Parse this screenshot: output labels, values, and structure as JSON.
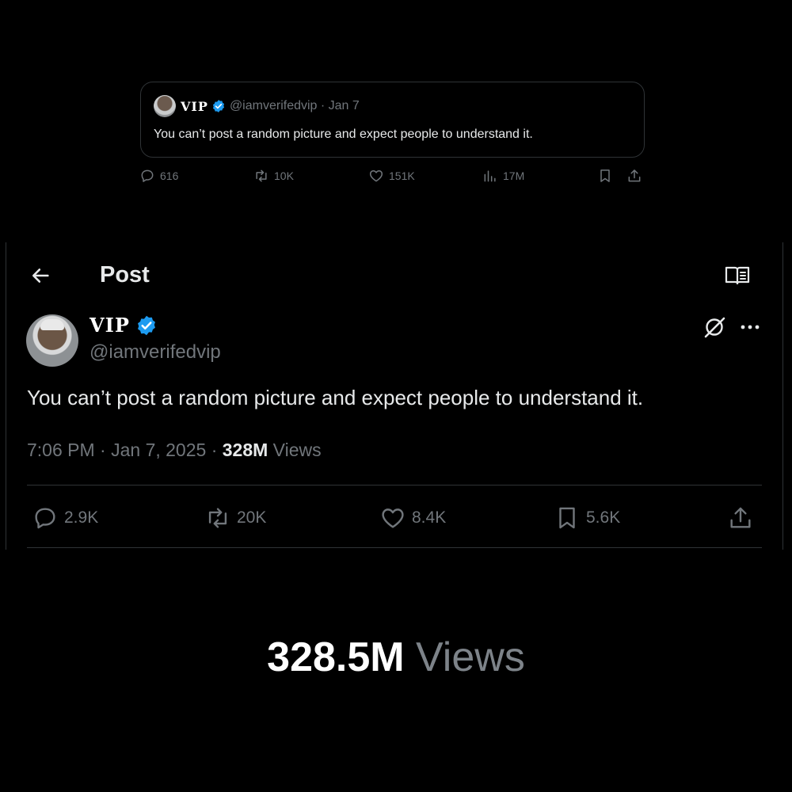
{
  "quote": {
    "display_name": "VIP",
    "handle_and_date": "@iamverifedvip · Jan 7",
    "text": "You can’t post a random picture and expect people to understand it.",
    "actions": {
      "replies": "616",
      "reposts": "10K",
      "likes": "151K",
      "views": "17M"
    }
  },
  "post": {
    "page_title": "Post",
    "display_name": "VIP",
    "handle": "@iamverifedvip",
    "text": "You can’t post a random picture and expect people to understand it.",
    "timestamp": "7:06 PM · Jan 7, 2025 · ",
    "views_count": "328M",
    "views_label": " Views",
    "actions": {
      "replies": "2.9K",
      "reposts": "20K",
      "likes": "8.4K",
      "bookmarks": "5.6K"
    }
  },
  "caption": {
    "number": "328.5M",
    "label": " Views"
  },
  "colors": {
    "background": "#000000",
    "text_primary": "#e7e9ea",
    "text_secondary": "#71767b",
    "border": "#2f3336",
    "verified_blue": "#1d9bf0"
  },
  "icons": {
    "reply": "reply-icon",
    "repost": "repost-icon",
    "like": "heart-icon",
    "views": "views-chart-icon",
    "bookmark": "bookmark-icon",
    "share": "share-icon",
    "back": "back-arrow-icon",
    "reader": "reader-mode-icon",
    "grok": "grok-icon",
    "more": "more-icon",
    "verified": "verified-badge-icon"
  }
}
